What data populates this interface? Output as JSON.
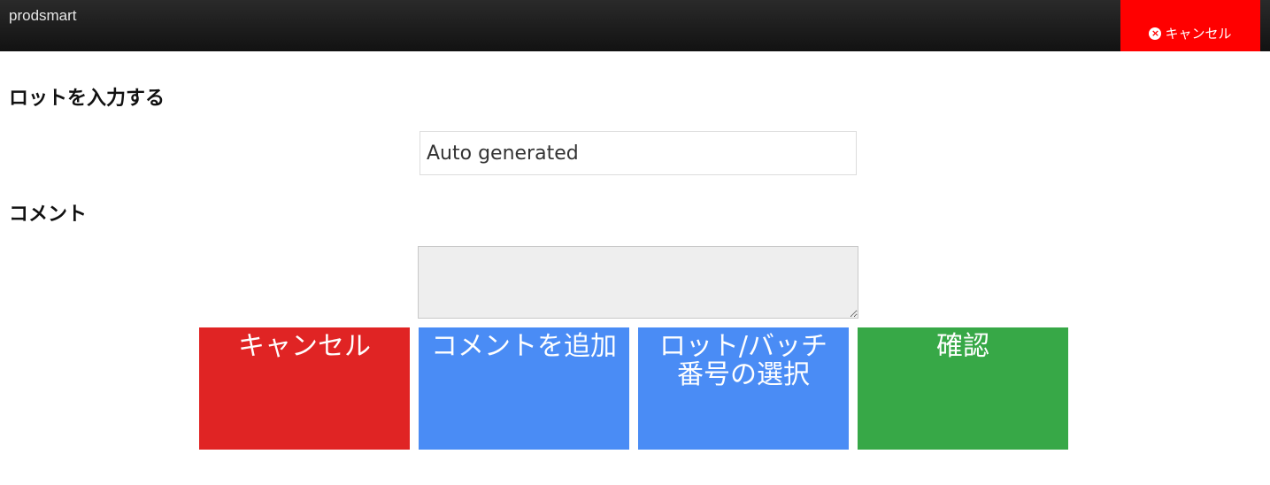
{
  "app": {
    "brand": "prodsmart"
  },
  "header": {
    "cancel_label": "キャンセル",
    "cancel_icon": "x-circle-icon",
    "cancel_color": "#ff0000"
  },
  "lot": {
    "heading": "ロットを入力する",
    "input_value": "Auto generated"
  },
  "comment": {
    "heading": "コメント",
    "textarea_value": ""
  },
  "actions": {
    "cancel_label": "キャンセル",
    "add_comment_label": "コメントを追加",
    "select_lot_label": "ロット/バッチ番号の選択",
    "confirm_label": "確認",
    "colors": {
      "cancel": "#e02424",
      "add_comment": "#4a8cf5",
      "select_lot": "#4a8cf5",
      "confirm": "#37a847"
    }
  }
}
